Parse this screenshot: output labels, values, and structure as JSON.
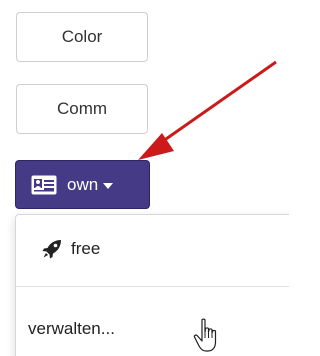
{
  "buttons": {
    "color_label": "Color",
    "comm_label": "Comm"
  },
  "own_button": {
    "label": "own",
    "icon": "id-card-icon",
    "caret_icon": "caret-down-icon",
    "bg_color": "#443a85"
  },
  "dropdown": {
    "items": [
      {
        "label": "free",
        "icon": "rocket-icon"
      },
      {
        "label": "verwalten..."
      }
    ]
  },
  "annotation": {
    "arrow_color": "#cc1a1a"
  }
}
